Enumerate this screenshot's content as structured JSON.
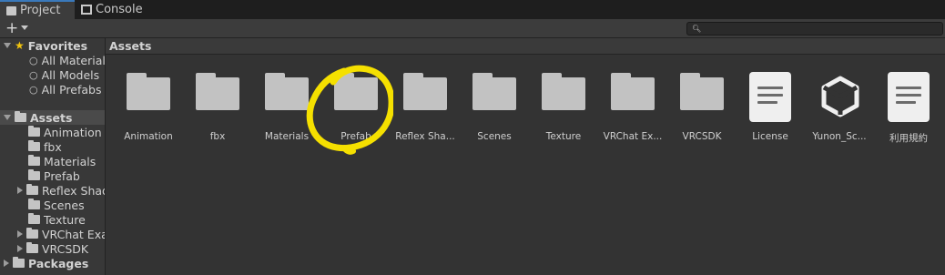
{
  "tabs": [
    {
      "label": "Project",
      "icon": "folder-icon",
      "active": true
    },
    {
      "label": "Console",
      "icon": "console-icon",
      "active": false
    }
  ],
  "toolbar": {
    "add_label": "+",
    "search_placeholder": ""
  },
  "left_panel": {
    "favorites": {
      "label": "Favorites",
      "items": [
        "All Materials",
        "All Models",
        "All Prefabs"
      ]
    },
    "assets": {
      "label": "Assets",
      "items": [
        "Animation",
        "fbx",
        "Materials",
        "Prefab",
        "Reflex Shad",
        "Scenes",
        "Texture",
        "VRChat Exa",
        "VRCSDK"
      ]
    },
    "packages": {
      "label": "Packages"
    }
  },
  "main": {
    "header": "Assets",
    "items": [
      {
        "label": "Animation",
        "kind": "folder"
      },
      {
        "label": "fbx",
        "kind": "folder"
      },
      {
        "label": "Materials",
        "kind": "folder"
      },
      {
        "label": "Prefab",
        "kind": "folder"
      },
      {
        "label": "Reflex Sha...",
        "kind": "folder"
      },
      {
        "label": "Scenes",
        "kind": "folder"
      },
      {
        "label": "Texture",
        "kind": "folder"
      },
      {
        "label": "VRChat Ex...",
        "kind": "folder"
      },
      {
        "label": "VRCSDK",
        "kind": "folder"
      },
      {
        "label": "License",
        "kind": "document"
      },
      {
        "label": "Yunon_Sc...",
        "kind": "unity-scene"
      },
      {
        "label": "利用規約",
        "kind": "document"
      }
    ]
  },
  "colors": {
    "accent": "#3a79bb",
    "highlight": "#f5e000",
    "star": "#f1c40f"
  }
}
